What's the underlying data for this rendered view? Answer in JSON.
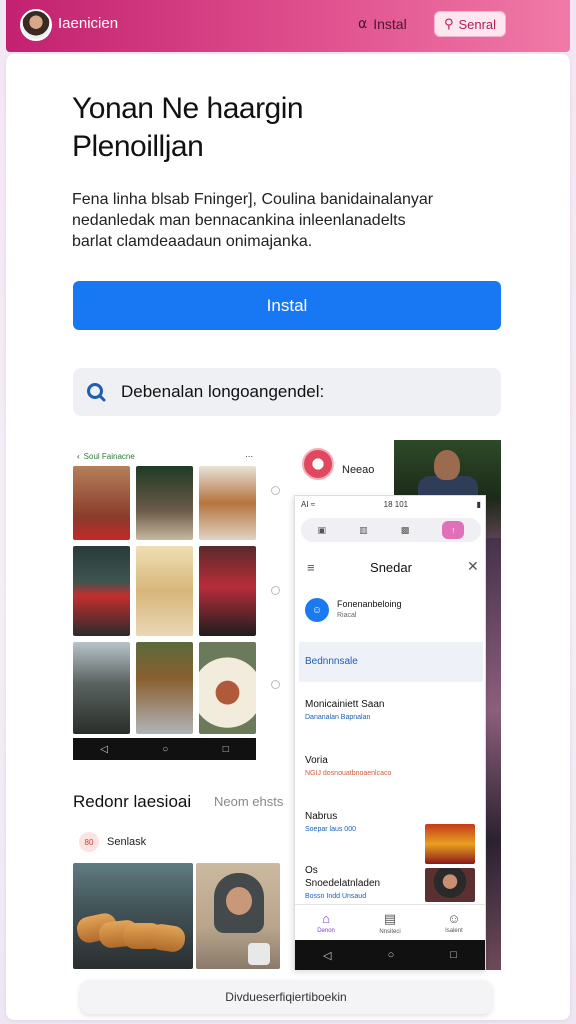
{
  "topbar": {
    "brand": "Iaenicien",
    "install_link": "Instal",
    "search_button": "Senral",
    "colors": {
      "start": "#c2216f",
      "end": "#f07aa7"
    }
  },
  "hero": {
    "headline": [
      "Yonan Ne haargin",
      "Plenoilljan"
    ],
    "description": [
      "Fena linha blsab Fninger], Coulina banidainalanyar",
      "nedanledak man bennacankina inleenlanadelts",
      "barlat clamdeaadaun onimajanka."
    ],
    "primary_button": "Instal",
    "primary_color": "#1877f2"
  },
  "search": {
    "text": "Debenalan longoangendel:"
  },
  "left_screenshot": {
    "header": "Soul Fainacne",
    "nav": [
      "◁",
      "○",
      "□"
    ]
  },
  "right_screenshot": {
    "brand": "Neeao",
    "status_left": "AI ≈",
    "status_time": "18 101",
    "title": "Snedar",
    "row1_title": "Fonenanbeloing",
    "row1_sub": "Riacal",
    "section_label": "Bednnnsale",
    "items": [
      {
        "title": "Monicainiett Saan",
        "sub": "Dananalan Bapnalan"
      },
      {
        "title": "Voria",
        "sub": "NGIJ dosnouatbnoaenlcaco"
      },
      {
        "title": "Nabrus",
        "sub": "Soepar laus 000"
      },
      {
        "title": "Os",
        "sub": ""
      },
      {
        "title": "Snoedelatnladen",
        "sub": "Bossn Indd Unsaud"
      }
    ],
    "bottom_nav": [
      "Denon",
      "Nnsiteci",
      "Isalent"
    ],
    "sys_nav": [
      "◁",
      "○",
      "□"
    ]
  },
  "section2": {
    "title": "Redonr laesioai",
    "alt": "Neom ehsts",
    "row_badge": "80",
    "row_label": "Senlask"
  },
  "bottom_pill": {
    "label": "Divdueserfiqiertiboekin"
  }
}
